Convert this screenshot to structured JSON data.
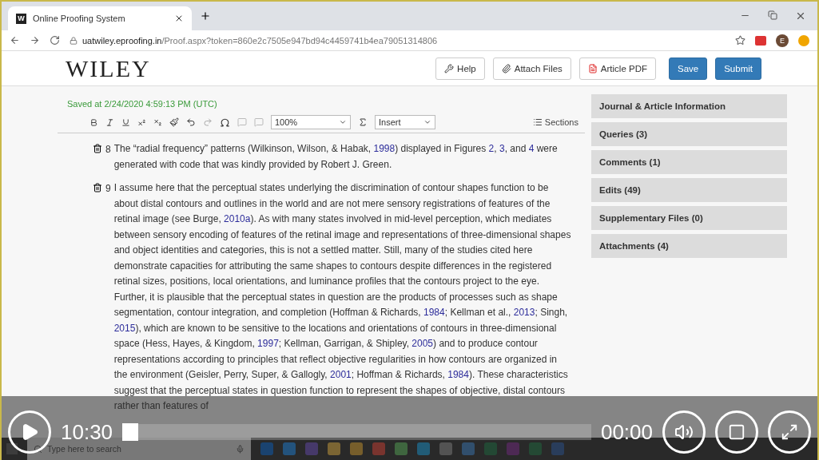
{
  "browser": {
    "favicon_letter": "W",
    "tab_title": "Online Proofing System",
    "url_host": "uatwiley.eproofing.in",
    "url_path": "/Proof.aspx?token=860e2c7505e947bd94c4459741b4ea79051314806",
    "profile_initial": "E"
  },
  "header": {
    "logo": "WILEY",
    "buttons": [
      {
        "label": "Help",
        "kind": "help"
      },
      {
        "label": "Attach Files",
        "kind": "attach"
      },
      {
        "label": "Article PDF",
        "kind": "pdf"
      },
      {
        "label": "Save",
        "kind": "primary"
      },
      {
        "label": "Submit",
        "kind": "primary"
      }
    ]
  },
  "saved_status": "Saved at 2/24/2020 4:59:13 PM (UTC)",
  "toolbar": {
    "zoom": "100%",
    "insert": "Insert",
    "sections": "Sections"
  },
  "paragraphs": [
    {
      "number": "8",
      "segments": [
        {
          "text": "The “radial frequency” patterns (Wilkinson, Wilson, & Habak, ",
          "link": false
        },
        {
          "text": "1998",
          "link": true
        },
        {
          "text": ") displayed in Figures ",
          "link": false
        },
        {
          "text": "2",
          "link": true
        },
        {
          "text": ", ",
          "link": false
        },
        {
          "text": "3",
          "link": true
        },
        {
          "text": ", and ",
          "link": false
        },
        {
          "text": "4",
          "link": true
        },
        {
          "text": " were generated with code that was kindly provided by Robert J. Green.",
          "link": false
        }
      ]
    },
    {
      "number": "9",
      "segments": [
        {
          "text": "I assume here that the perceptual states underlying the discrimination of contour shapes function to be about distal contours and outlines in the world and are not mere sensory registrations of features of the retinal image (see Burge, ",
          "link": false
        },
        {
          "text": "2010a",
          "link": true
        },
        {
          "text": "). As with many states involved in mid-level perception, which mediates between sensory encoding of features of the retinal image and representations of three-dimensional shapes and object identities and categories, this is not a settled matter. Still, many of the studies cited here demonstrate capacities for attributing the same shapes to contours despite differences in the registered retinal sizes, positions, local orientations, and luminance profiles that the contours project to the eye. Further, it is plausible that the perceptual states in question are the products of processes such as shape segmentation, contour integration, and completion (Hoffman & Richards, ",
          "link": false
        },
        {
          "text": "1984",
          "link": true
        },
        {
          "text": "; Kellman et al., ",
          "link": false
        },
        {
          "text": "2013",
          "link": true
        },
        {
          "text": "; Singh, ",
          "link": false
        },
        {
          "text": "2015",
          "link": true
        },
        {
          "text": "), which are known to be sensitive to the locations and orientations of contours in three-dimensional space (Hess, Hayes, & Kingdom, ",
          "link": false
        },
        {
          "text": "1997",
          "link": true
        },
        {
          "text": "; Kellman, Garrigan, & Shipley, ",
          "link": false
        },
        {
          "text": "2005",
          "link": true
        },
        {
          "text": ") and to produce contour representations according to principles that reflect objective regularities in how contours are organized in the environment (Geisler, Perry, Super, & Gallogly, ",
          "link": false
        },
        {
          "text": "2001",
          "link": true
        },
        {
          "text": "; Hoffman & Richards, ",
          "link": false
        },
        {
          "text": "1984",
          "link": true
        },
        {
          "text": "). These characteristics suggest that the perceptual states in question function to represent the shapes of objective, distal contours rather than features of",
          "link": false
        }
      ]
    }
  ],
  "sidebar": {
    "items": [
      "Journal & Article Information",
      "Queries (3)",
      "Comments (1)",
      "Edits (49)",
      "Supplementary Files (0)",
      "Attachments (4)"
    ]
  },
  "video": {
    "elapsed": "10:30",
    "remaining": "00:00"
  },
  "taskbar": {
    "search_placeholder": "Type here to search"
  }
}
